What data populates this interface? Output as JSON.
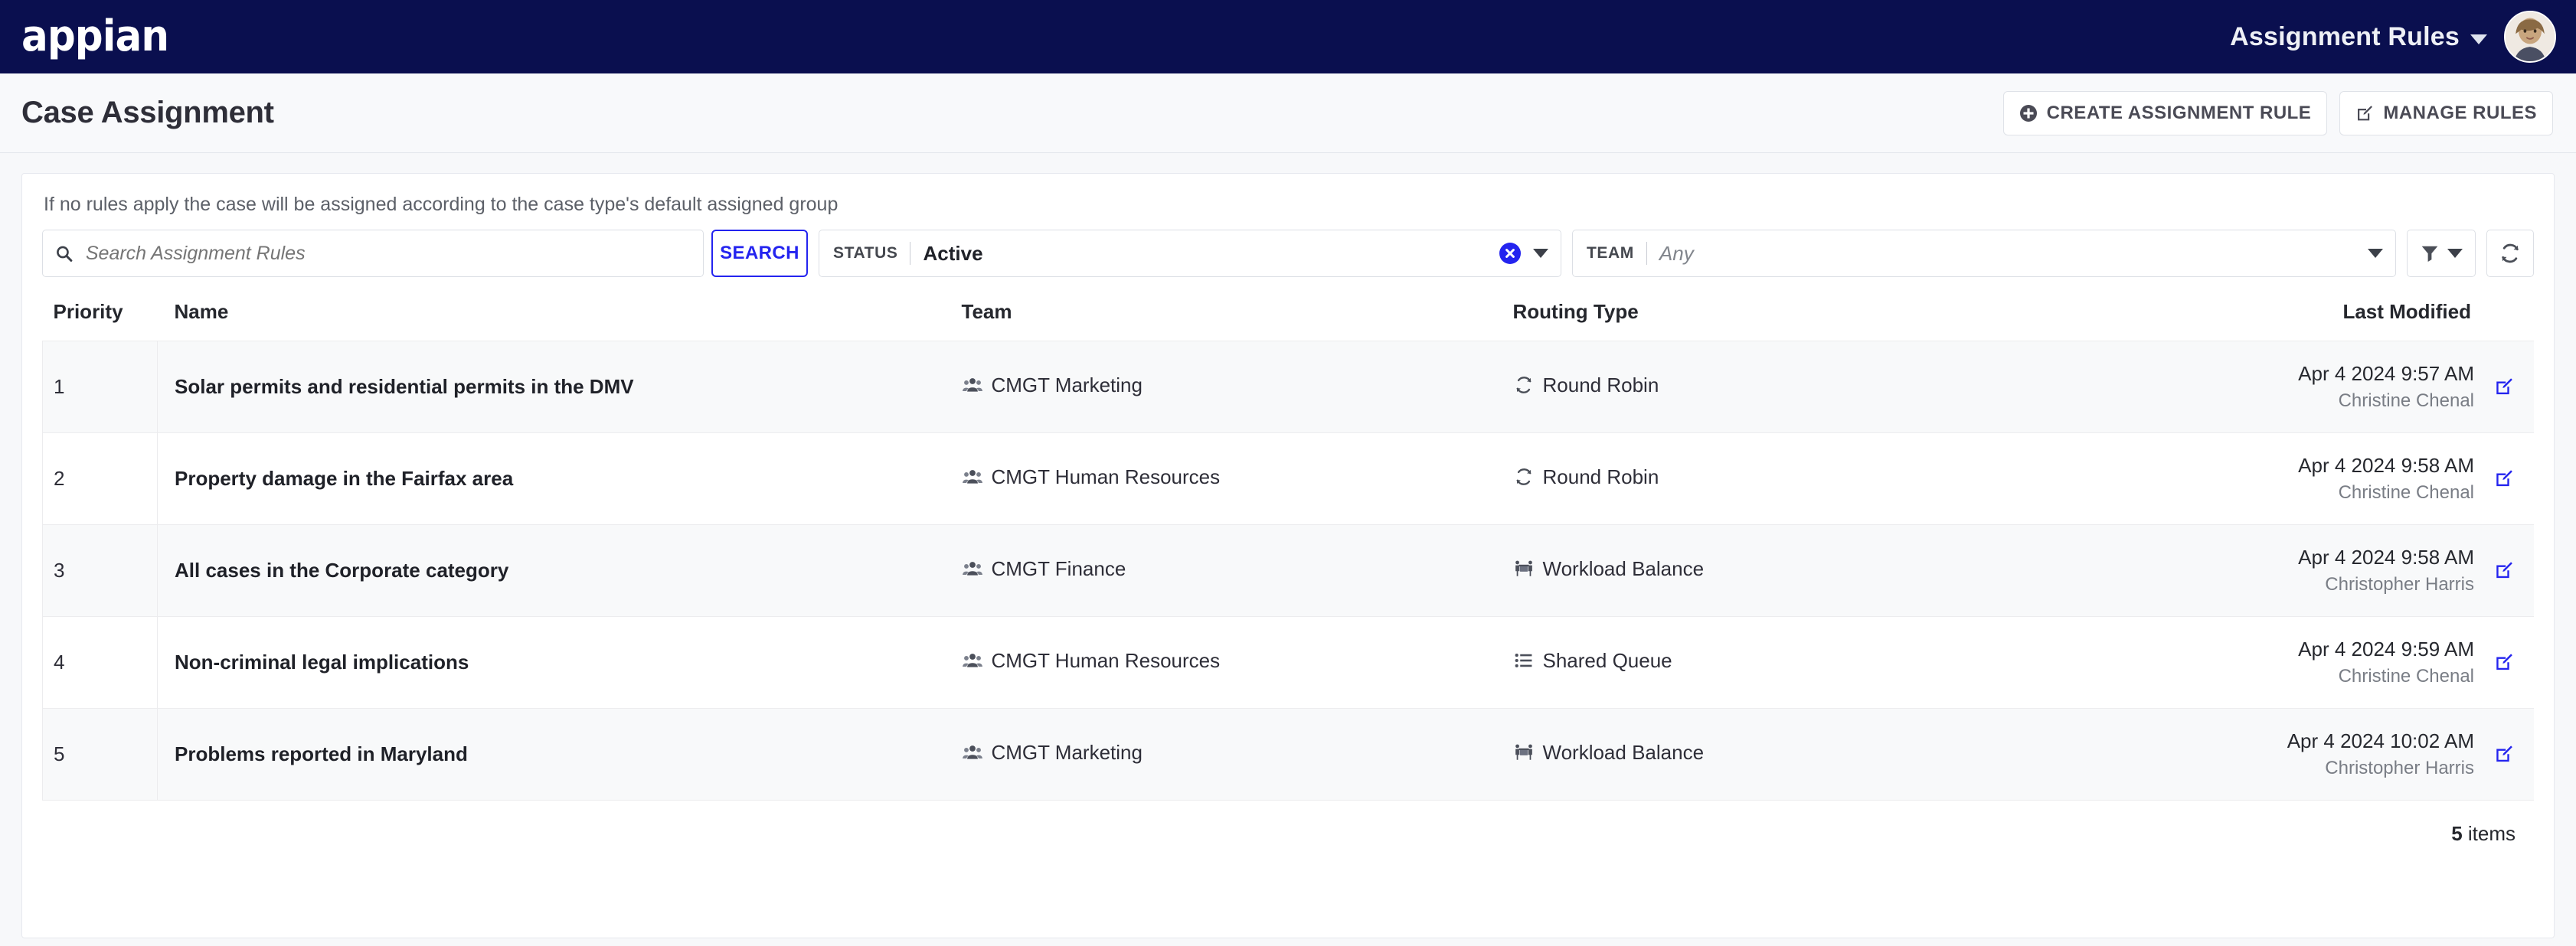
{
  "topbar": {
    "logo_text": "appian",
    "menu_label": "Assignment Rules",
    "menu_caret_icon": "chevron-down-icon",
    "avatar_icon": "user-avatar"
  },
  "titlebar": {
    "title": "Case Assignment",
    "actions": [
      {
        "label": "CREATE ASSIGNMENT RULE",
        "icon": "plus-circle-icon"
      },
      {
        "label": "MANAGE RULES",
        "icon": "edit-pencil-icon"
      }
    ]
  },
  "card": {
    "hint": "If no rules apply the case will be assigned according to the case type's default assigned group",
    "search": {
      "placeholder": "Search Assignment Rules",
      "value": "",
      "icon": "search-icon",
      "button_label": "SEARCH"
    },
    "status_filter": {
      "label": "STATUS",
      "value": "Active",
      "clear_icon": "clear-circle-x-icon",
      "caret_icon": "triangle-down-icon"
    },
    "team_filter": {
      "label": "TEAM",
      "value": "Any",
      "caret_icon": "triangle-down-icon"
    },
    "filter_button": {
      "icon": "funnel-icon",
      "caret_icon": "triangle-down-icon"
    },
    "refresh_button": {
      "icon": "refresh-icon"
    }
  },
  "table": {
    "columns": {
      "priority": "Priority",
      "name": "Name",
      "team": "Team",
      "routing_type": "Routing Type",
      "last_modified": "Last Modified"
    },
    "rows": [
      {
        "priority": "1",
        "name": "Solar permits and residential permits in the DMV",
        "team": "CMGT Marketing",
        "team_icon": "users-group-icon",
        "routing_type": "Round Robin",
        "routing_icon": "round-robin-icon",
        "modified_date": "Apr 4 2024 9:57 AM",
        "modified_by": "Christine Chenal",
        "edit_icon": "edit-pencil-icon"
      },
      {
        "priority": "2",
        "name": "Property damage in the Fairfax area",
        "team": "CMGT Human Resources",
        "team_icon": "users-group-icon",
        "routing_type": "Round Robin",
        "routing_icon": "round-robin-icon",
        "modified_date": "Apr 4 2024 9:58 AM",
        "modified_by": "Christine Chenal",
        "edit_icon": "edit-pencil-icon"
      },
      {
        "priority": "3",
        "name": "All cases in the Corporate category",
        "team": "CMGT Finance",
        "team_icon": "users-group-icon",
        "routing_type": "Workload Balance",
        "routing_icon": "workload-balance-icon",
        "modified_date": "Apr 4 2024 9:58 AM",
        "modified_by": "Christopher Harris",
        "edit_icon": "edit-pencil-icon"
      },
      {
        "priority": "4",
        "name": "Non-criminal legal implications",
        "team": "CMGT Human Resources",
        "team_icon": "users-group-icon",
        "routing_type": "Shared Queue",
        "routing_icon": "list-icon",
        "modified_date": "Apr 4 2024 9:59 AM",
        "modified_by": "Christine Chenal",
        "edit_icon": "edit-pencil-icon"
      },
      {
        "priority": "5",
        "name": "Problems reported in Maryland",
        "team": "CMGT Marketing",
        "team_icon": "users-group-icon",
        "routing_type": "Workload Balance",
        "routing_icon": "workload-balance-icon",
        "modified_date": "Apr 4 2024 10:02 AM",
        "modified_by": "Christopher Harris",
        "edit_icon": "edit-pencil-icon"
      }
    ],
    "footer_count": "5",
    "footer_label": " items"
  },
  "colors": {
    "brand_navy": "#0a0f4f",
    "accent_blue": "#2424ef",
    "page_bg": "#f7f8fa",
    "card_bg": "#ffffff"
  }
}
